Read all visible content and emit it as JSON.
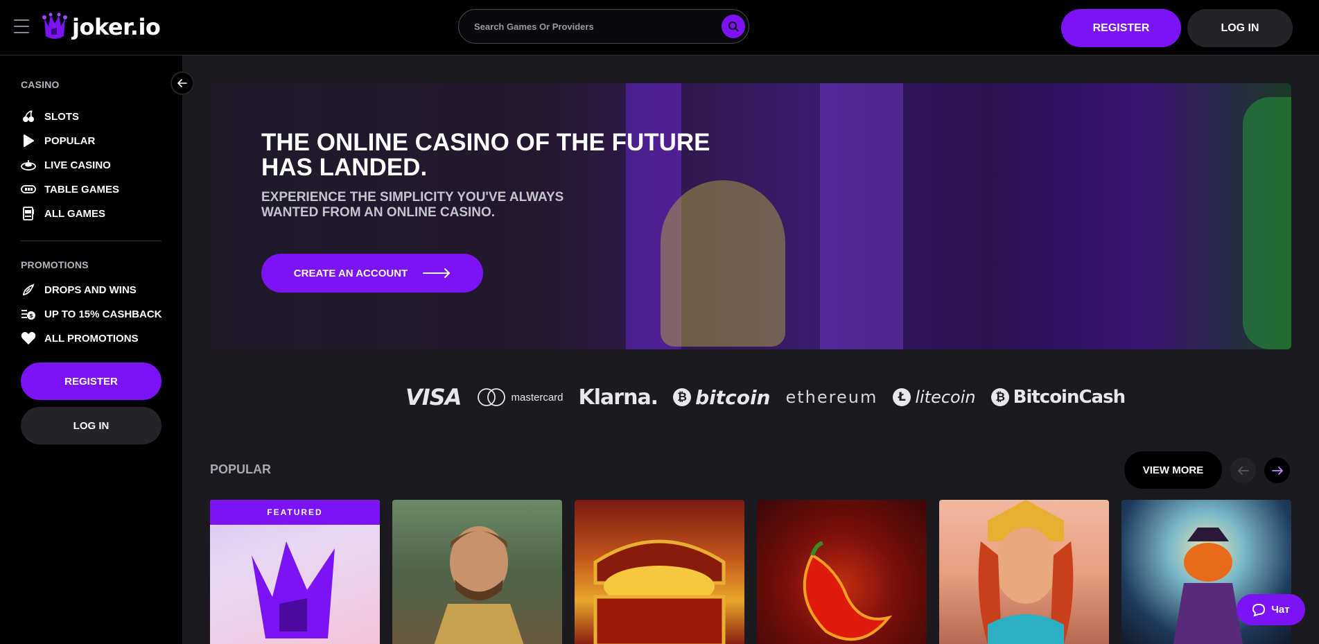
{
  "header": {
    "logo_text": "joker.io",
    "search_placeholder": "Search Games Or Providers",
    "register_label": "REGISTER",
    "login_label": "LOG IN"
  },
  "sidebar": {
    "casino_title": "CASINO",
    "casino_items": [
      {
        "label": "SLOTS",
        "icon": "cherries-icon"
      },
      {
        "label": "POPULAR",
        "icon": "play-icon"
      },
      {
        "label": "LIVE CASINO",
        "icon": "roulette-icon"
      },
      {
        "label": "TABLE GAMES",
        "icon": "card-table-icon"
      },
      {
        "label": "ALL GAMES",
        "icon": "slot-machine-icon"
      }
    ],
    "promotions_title": "PROMOTIONS",
    "promotion_items": [
      {
        "label": "DROPS AND WINS",
        "icon": "rocket-icon"
      },
      {
        "label": "UP TO 15% CASHBACK",
        "icon": "cashback-icon"
      },
      {
        "label": "ALL PROMOTIONS",
        "icon": "heart-icon"
      }
    ],
    "register_label": "REGISTER",
    "login_label": "LOG IN"
  },
  "hero": {
    "title": "THE ONLINE CASINO OF THE FUTURE HAS LANDED.",
    "subtitle": "EXPERIENCE THE SIMPLICITY YOU'VE ALWAYS WANTED FROM AN ONLINE CASINO.",
    "cta_label": "CREATE AN ACCOUNT"
  },
  "payments": {
    "visa": "VISA",
    "mastercard": "mastercard",
    "klarna": "Klarna.",
    "bitcoin": "bitcoin",
    "ethereum": "ethereum",
    "litecoin": "litecoin",
    "bitcoincash": "BitcoinCash"
  },
  "popular": {
    "title": "POPULAR",
    "view_more_label": "VIEW MORE",
    "featured_label": "FEATURED"
  },
  "chat": {
    "label": "Чат"
  },
  "colors": {
    "accent": "#7b13f5",
    "background": "#1b1b1f",
    "sidebar": "#000000",
    "secondary_button": "#232328"
  }
}
